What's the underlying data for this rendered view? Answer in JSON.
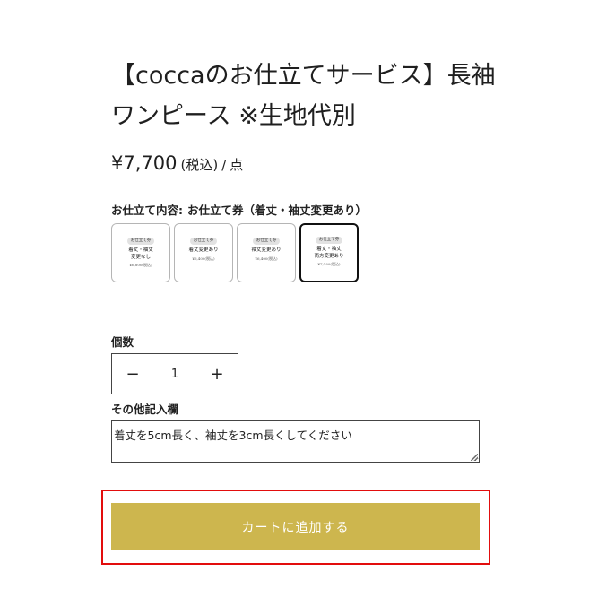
{
  "product": {
    "title": "【coccaのお仕立てサービス】長袖ワンピース ※生地代別",
    "price": "¥7,700",
    "tax_note": "(税込)",
    "separator": "/",
    "unit": "点"
  },
  "option": {
    "label": "お仕立て内容:",
    "selected_value": "お仕立て券（着丈・袖丈変更あり）",
    "swatches": [
      {
        "badge": "お仕立て券",
        "name": "着丈・袖丈\n変更なし",
        "price": "¥6,800(税込)",
        "selected": false
      },
      {
        "badge": "お仕立て券",
        "name": "着丈変更あり",
        "price": "¥6,400(税込)",
        "selected": false
      },
      {
        "badge": "お仕立て券",
        "name": "袖丈変更あり",
        "price": "¥6,400(税込)",
        "selected": false
      },
      {
        "badge": "お仕立て券",
        "name": "着丈・袖丈\n両方変更あり",
        "price": "¥7,700(税込)",
        "selected": true
      }
    ]
  },
  "quantity": {
    "label": "個数",
    "minus": "−",
    "value": "1",
    "plus": "+"
  },
  "notes": {
    "label": "その他記入欄",
    "value": "着丈を5cm長く、袖丈を3cm長くしてください"
  },
  "cart": {
    "button_label": "カートに追加する",
    "button_color": "#cdb64e",
    "highlight_color": "#e20d0d"
  }
}
